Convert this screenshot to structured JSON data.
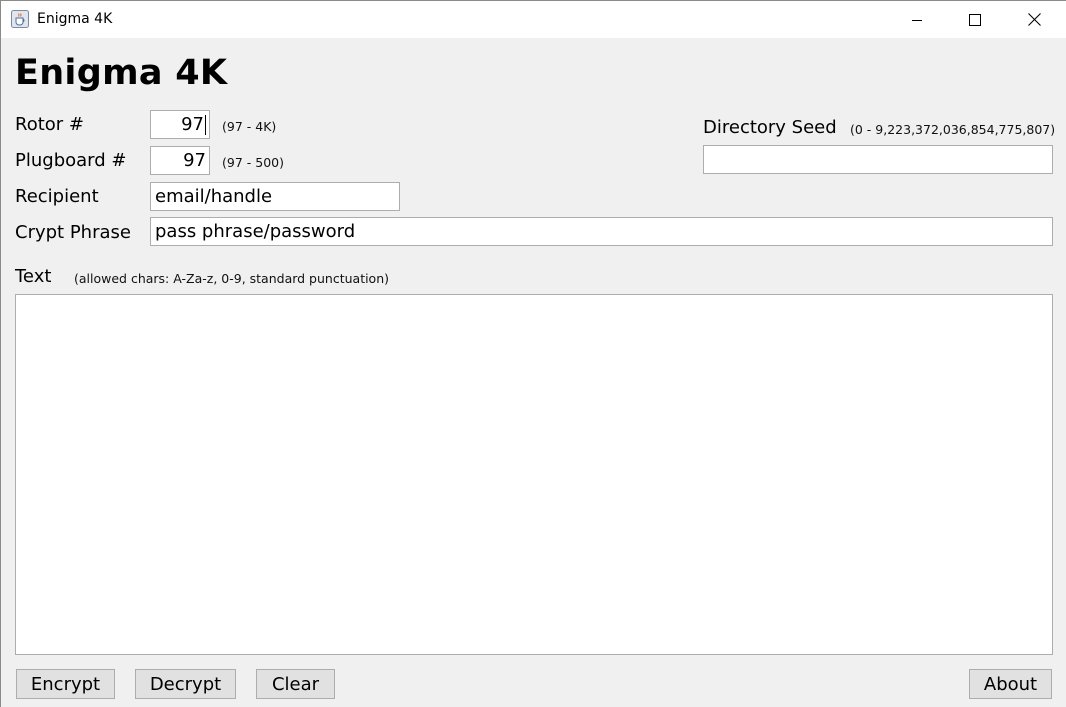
{
  "window": {
    "title": "Enigma 4K",
    "app_icon": "java-cup-icon",
    "controls": [
      "minimize-icon",
      "maximize-icon",
      "close-icon"
    ]
  },
  "heading": "Enigma 4K",
  "rotor": {
    "label": "Rotor #",
    "value": "97",
    "range": "(97 - 4K)"
  },
  "plugboard": {
    "label": "Plugboard #",
    "value": "97",
    "range": "(97 - 500)"
  },
  "recipient": {
    "label": "Recipient",
    "value": "email/handle"
  },
  "crypt_phrase": {
    "label": "Crypt Phrase",
    "value": "pass phrase/password"
  },
  "directory_seed": {
    "label": "Directory Seed",
    "range": "(0 - 9,223,372,036,854,775,807)",
    "value": ""
  },
  "text": {
    "label": "Text",
    "hint": "(allowed chars: A-Za-z, 0-9, standard punctuation)",
    "value": ""
  },
  "buttons": {
    "encrypt": "Encrypt",
    "decrypt": "Decrypt",
    "clear": "Clear",
    "about": "About"
  }
}
